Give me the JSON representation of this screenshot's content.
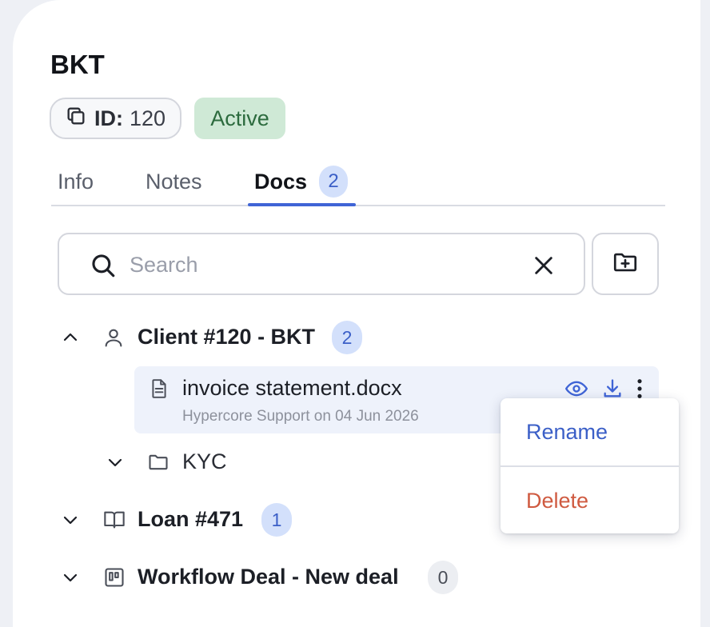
{
  "record": {
    "title": "BKT",
    "id_label": "ID:",
    "id_value": "120",
    "status": "Active"
  },
  "tabs": [
    {
      "label": "Info"
    },
    {
      "label": "Notes"
    },
    {
      "label": "Docs",
      "count": "2",
      "active": true
    }
  ],
  "search": {
    "placeholder": "Search",
    "value": ""
  },
  "tree": {
    "client": {
      "label": "Client #120 - BKT",
      "count": "2",
      "expanded": true
    },
    "file": {
      "name": "invoice statement.docx",
      "meta": "Hypercore Support on 04 Jun 2026"
    },
    "kyc": {
      "label": "KYC"
    },
    "loan": {
      "label": "Loan #471",
      "count": "1"
    },
    "workflow": {
      "label": "Workflow Deal - New deal",
      "count": "0"
    }
  },
  "context_menu": {
    "rename": "Rename",
    "delete": "Delete"
  },
  "colors": {
    "accent": "#3f64d6",
    "active_green_bg": "#cfe9d6",
    "active_green_text": "#2c6b3e",
    "delete_red": "#cf5a40",
    "badge_blue_bg": "#d3e0fb"
  },
  "icons": [
    "copy-icon",
    "search-icon",
    "close-icon",
    "folder-plus-icon",
    "chevron-up-icon",
    "user-icon",
    "document-icon",
    "eye-icon",
    "download-icon",
    "more-vertical-icon",
    "chevron-down-icon",
    "folder-icon",
    "book-icon",
    "board-icon"
  ]
}
